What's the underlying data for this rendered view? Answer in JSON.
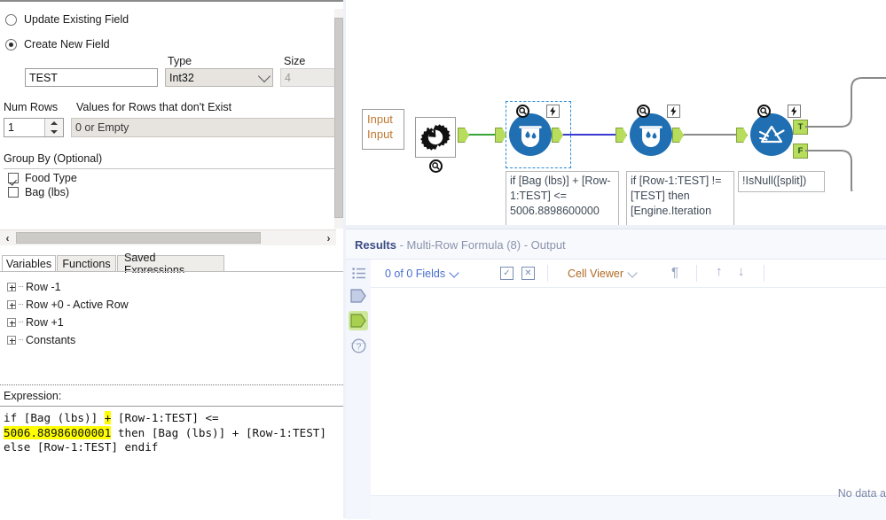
{
  "config": {
    "radio_update": "Update Existing Field",
    "radio_create": "Create New  Field",
    "field_name_value": "TEST",
    "type_label": "Type",
    "type_value": "Int32",
    "size_label": "Size",
    "size_value": "4",
    "num_rows_label": "Num Rows",
    "num_rows_value": "1",
    "values_rows_label": "Values for Rows that don't Exist",
    "values_rows_value": "0 or Empty",
    "group_by_label": "Group By (Optional)",
    "group_by_items": [
      {
        "label": "Food Type",
        "checked": true
      },
      {
        "label": "Bag (lbs)",
        "checked": false
      }
    ],
    "scroll_left_arrow": "‹",
    "scroll_right_arrow": "›"
  },
  "tabs": [
    {
      "label": "Variables",
      "active": true
    },
    {
      "label": "Functions",
      "active": false
    },
    {
      "label": "Saved Expressions",
      "active": false
    }
  ],
  "variables_tree": [
    {
      "label": "Row -1"
    },
    {
      "label": "Row +0 - Active Row"
    },
    {
      "label": "Row +1"
    },
    {
      "label": "Constants"
    }
  ],
  "expression": {
    "label": "Expression:",
    "part1": "if [Bag (lbs)] ",
    "highlight1": "+",
    "part2": " [Row-1:TEST] <=\n",
    "highlight2": "5006.88986000001",
    "part3": " then [Bag (lbs)] + [Row-1:TEST] else [Row-1:TEST] endif"
  },
  "canvas": {
    "input_box_line1": "Input",
    "input_box_line2": "Input",
    "macro_tool_name": "macro-tool",
    "nodes": [
      {
        "name": "multi-row-formula-1",
        "icon": "multi-row-formula-icon",
        "selected": true,
        "annotation": "if [Bag (lbs)] + [Row-1:TEST] <= 5006.8898600000"
      },
      {
        "name": "multi-row-formula-2",
        "icon": "multi-row-formula-icon",
        "selected": false,
        "annotation": "if [Row-1:TEST] != [TEST] then [Engine.Iteration"
      },
      {
        "name": "filter-tool",
        "icon": "filter-icon",
        "selected": false,
        "annotation": "!IsNull([split])",
        "out_true": "T",
        "out_false": "F"
      }
    ],
    "badge_q": "Q",
    "badge_lightning": "⚡"
  },
  "results": {
    "title": "Results",
    "subtitle": " - Multi-Row Formula (8) - Output",
    "toolbar": {
      "fields_selector": "0 of 0 Fields",
      "cell_viewer": "Cell Viewer",
      "pilcrow": "¶",
      "arrow_up": "↑",
      "arrow_down": "↓",
      "select_all_icon": "select-all-icon",
      "deselect_all_icon": "deselect-all-icon"
    },
    "rail": [
      {
        "name": "rail-item-list",
        "icon": "list-icon",
        "selected": false
      },
      {
        "name": "rail-item-input-anchor",
        "icon": "input-anchor-icon",
        "selected": false
      },
      {
        "name": "rail-item-output-anchor",
        "icon": "output-anchor-icon",
        "selected": true
      },
      {
        "name": "rail-item-help",
        "icon": "help-circle-icon",
        "selected": false
      }
    ],
    "no_data_message": "No data a"
  },
  "colors": {
    "node_blue": "#1f6fb2",
    "anchor_green": "#b8dc5c",
    "wire_green": "#37a437",
    "wire_blue": "#3a3ad0",
    "wire_grey": "#8a8a8a",
    "selection_blue": "#2d8bd6",
    "highlight_yellow": "#ffff00",
    "results_accent": "#4a6fd0"
  }
}
